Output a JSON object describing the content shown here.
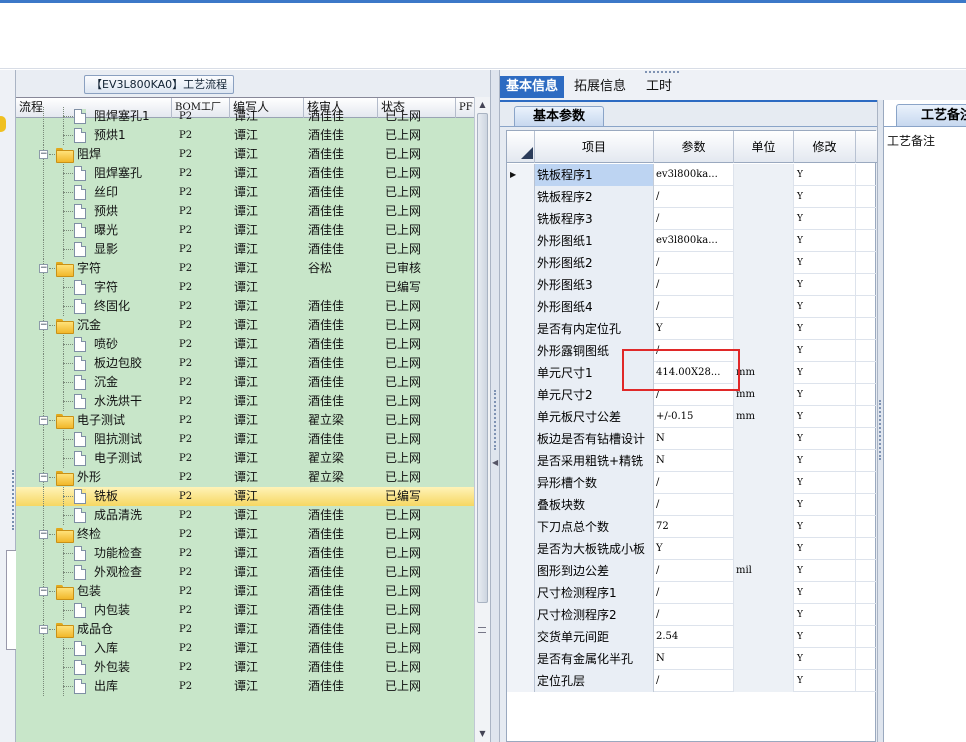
{
  "left_panel": {
    "caption": "【EV3L800KA0】工艺流程",
    "columns": [
      "流程",
      "BOM工厂",
      "编写人",
      "核审人",
      "状态",
      "PF"
    ],
    "rows": [
      {
        "label": "阻焊塞孔1",
        "level": 1,
        "bom": "P2",
        "writer": "谭江",
        "reviewer": "酒佳佳",
        "status": "已上网"
      },
      {
        "label": "预烘1",
        "level": 1,
        "bom": "P2",
        "writer": "谭江",
        "reviewer": "酒佳佳",
        "status": "已上网"
      },
      {
        "label": "阻焊",
        "level": 0,
        "bom": "P2",
        "writer": "谭江",
        "reviewer": "酒佳佳",
        "status": "已上网"
      },
      {
        "label": "阻焊塞孔",
        "level": 1,
        "bom": "P2",
        "writer": "谭江",
        "reviewer": "酒佳佳",
        "status": "已上网"
      },
      {
        "label": "丝印",
        "level": 1,
        "bom": "P2",
        "writer": "谭江",
        "reviewer": "酒佳佳",
        "status": "已上网"
      },
      {
        "label": "预烘",
        "level": 1,
        "bom": "P2",
        "writer": "谭江",
        "reviewer": "酒佳佳",
        "status": "已上网"
      },
      {
        "label": "曝光",
        "level": 1,
        "bom": "P2",
        "writer": "谭江",
        "reviewer": "酒佳佳",
        "status": "已上网"
      },
      {
        "label": "显影",
        "level": 1,
        "bom": "P2",
        "writer": "谭江",
        "reviewer": "酒佳佳",
        "status": "已上网"
      },
      {
        "label": "字符",
        "level": 0,
        "bom": "P2",
        "writer": "谭江",
        "reviewer": "谷松",
        "status": "已审核"
      },
      {
        "label": "字符",
        "level": 1,
        "bom": "P2",
        "writer": "谭江",
        "reviewer": "",
        "status": "已编写"
      },
      {
        "label": "终固化",
        "level": 1,
        "bom": "P2",
        "writer": "谭江",
        "reviewer": "酒佳佳",
        "status": "已上网"
      },
      {
        "label": "沉金",
        "level": 0,
        "bom": "P2",
        "writer": "谭江",
        "reviewer": "酒佳佳",
        "status": "已上网"
      },
      {
        "label": "喷砂",
        "level": 1,
        "bom": "P2",
        "writer": "谭江",
        "reviewer": "酒佳佳",
        "status": "已上网"
      },
      {
        "label": "板边包胶",
        "level": 1,
        "bom": "P2",
        "writer": "谭江",
        "reviewer": "酒佳佳",
        "status": "已上网"
      },
      {
        "label": "沉金",
        "level": 1,
        "bom": "P2",
        "writer": "谭江",
        "reviewer": "酒佳佳",
        "status": "已上网"
      },
      {
        "label": "水洗烘干",
        "level": 1,
        "bom": "P2",
        "writer": "谭江",
        "reviewer": "酒佳佳",
        "status": "已上网"
      },
      {
        "label": "电子测试",
        "level": 0,
        "bom": "P2",
        "writer": "谭江",
        "reviewer": "翟立梁",
        "status": "已上网"
      },
      {
        "label": "阻抗测试",
        "level": 1,
        "bom": "P2",
        "writer": "谭江",
        "reviewer": "酒佳佳",
        "status": "已上网"
      },
      {
        "label": "电子测试",
        "level": 1,
        "bom": "P2",
        "writer": "谭江",
        "reviewer": "翟立梁",
        "status": "已上网"
      },
      {
        "label": "外形",
        "level": 0,
        "bom": "P2",
        "writer": "谭江",
        "reviewer": "翟立梁",
        "status": "已上网"
      },
      {
        "label": "铣板",
        "level": 1,
        "bom": "P2",
        "writer": "谭江",
        "reviewer": "",
        "status": "已编写",
        "selected": true
      },
      {
        "label": "成品清洗",
        "level": 1,
        "bom": "P2",
        "writer": "谭江",
        "reviewer": "酒佳佳",
        "status": "已上网"
      },
      {
        "label": "终检",
        "level": 0,
        "bom": "P2",
        "writer": "谭江",
        "reviewer": "酒佳佳",
        "status": "已上网"
      },
      {
        "label": "功能检查",
        "level": 1,
        "bom": "P2",
        "writer": "谭江",
        "reviewer": "酒佳佳",
        "status": "已上网"
      },
      {
        "label": "外观检查",
        "level": 1,
        "bom": "P2",
        "writer": "谭江",
        "reviewer": "酒佳佳",
        "status": "已上网"
      },
      {
        "label": "包装",
        "level": 0,
        "bom": "P2",
        "writer": "谭江",
        "reviewer": "酒佳佳",
        "status": "已上网"
      },
      {
        "label": "内包装",
        "level": 1,
        "bom": "P2",
        "writer": "谭江",
        "reviewer": "酒佳佳",
        "status": "已上网"
      },
      {
        "label": "成品仓",
        "level": 0,
        "bom": "P2",
        "writer": "谭江",
        "reviewer": "酒佳佳",
        "status": "已上网"
      },
      {
        "label": "入库",
        "level": 1,
        "bom": "P2",
        "writer": "谭江",
        "reviewer": "酒佳佳",
        "status": "已上网"
      },
      {
        "label": "外包装",
        "level": 1,
        "bom": "P2",
        "writer": "谭江",
        "reviewer": "酒佳佳",
        "status": "已上网"
      },
      {
        "label": "出库",
        "level": 1,
        "bom": "P2",
        "writer": "谭江",
        "reviewer": "酒佳佳",
        "status": "已上网"
      }
    ]
  },
  "tabs": {
    "items": [
      "基本信息",
      "拓展信息",
      "工时"
    ],
    "active": 0
  },
  "middle": {
    "subtab": "基本参数",
    "columns": [
      "项目",
      "参数",
      "单位",
      "修改"
    ],
    "rows": [
      {
        "name": "铣板程序1",
        "value": "ev3l800ka...",
        "unit": "",
        "mod": "Y"
      },
      {
        "name": "铣板程序2",
        "value": "/",
        "unit": "",
        "mod": "Y"
      },
      {
        "name": "铣板程序3",
        "value": "/",
        "unit": "",
        "mod": "Y"
      },
      {
        "name": "外形图纸1",
        "value": "ev3l800ka...",
        "unit": "",
        "mod": "Y"
      },
      {
        "name": "外形图纸2",
        "value": "/",
        "unit": "",
        "mod": "Y"
      },
      {
        "name": "外形图纸3",
        "value": "/",
        "unit": "",
        "mod": "Y"
      },
      {
        "name": "外形图纸4",
        "value": "/",
        "unit": "",
        "mod": "Y"
      },
      {
        "name": "是否有内定位孔",
        "value": "Y",
        "unit": "",
        "mod": "Y"
      },
      {
        "name": "外形露铜图纸",
        "value": "/",
        "unit": "",
        "mod": "Y"
      },
      {
        "name": "单元尺寸1",
        "value": "414.00X28...",
        "unit": "mm",
        "mod": "Y"
      },
      {
        "name": "单元尺寸2",
        "value": "/",
        "unit": "mm",
        "mod": "Y"
      },
      {
        "name": "单元板尺寸公差",
        "value": "+/-0.15",
        "unit": "mm",
        "mod": "Y"
      },
      {
        "name": "板边是否有钻槽设计",
        "value": "N",
        "unit": "",
        "mod": "Y"
      },
      {
        "name": "是否采用粗铣+精铣",
        "value": "N",
        "unit": "",
        "mod": "Y"
      },
      {
        "name": "异形槽个数",
        "value": "/",
        "unit": "",
        "mod": "Y"
      },
      {
        "name": "叠板块数",
        "value": "/",
        "unit": "",
        "mod": "Y"
      },
      {
        "name": "下刀点总个数",
        "value": "72",
        "unit": "",
        "mod": "Y"
      },
      {
        "name": "是否为大板铣成小板",
        "value": "Y",
        "unit": "",
        "mod": "Y"
      },
      {
        "name": "图形到边公差",
        "value": "/",
        "unit": "mil",
        "mod": "Y"
      },
      {
        "name": "尺寸检测程序1",
        "value": "/",
        "unit": "",
        "mod": "Y"
      },
      {
        "name": "尺寸检测程序2",
        "value": "/",
        "unit": "",
        "mod": "Y"
      },
      {
        "name": "交货单元间距",
        "value": "2.54",
        "unit": "",
        "mod": "Y"
      },
      {
        "name": "是否有金属化半孔",
        "value": "N",
        "unit": "",
        "mod": "Y"
      },
      {
        "name": "定位孔层",
        "value": "/",
        "unit": "",
        "mod": "Y"
      }
    ]
  },
  "right": {
    "tab": "工艺备注",
    "label": "工艺备注"
  },
  "icons": {
    "tree_expander": "minus-box-icon",
    "group_node": "folder-icon",
    "leaf_node": "document-icon",
    "row_indicator": "triangle-right-icon",
    "scroll_up": "arrow-up-icon",
    "scroll_down": "arrow-down-icon"
  },
  "colors": {
    "accent": "#2d6bc2",
    "tree_background": "#c8e6c9",
    "selection": "#f6d762",
    "highlight_box": "#e02828"
  }
}
